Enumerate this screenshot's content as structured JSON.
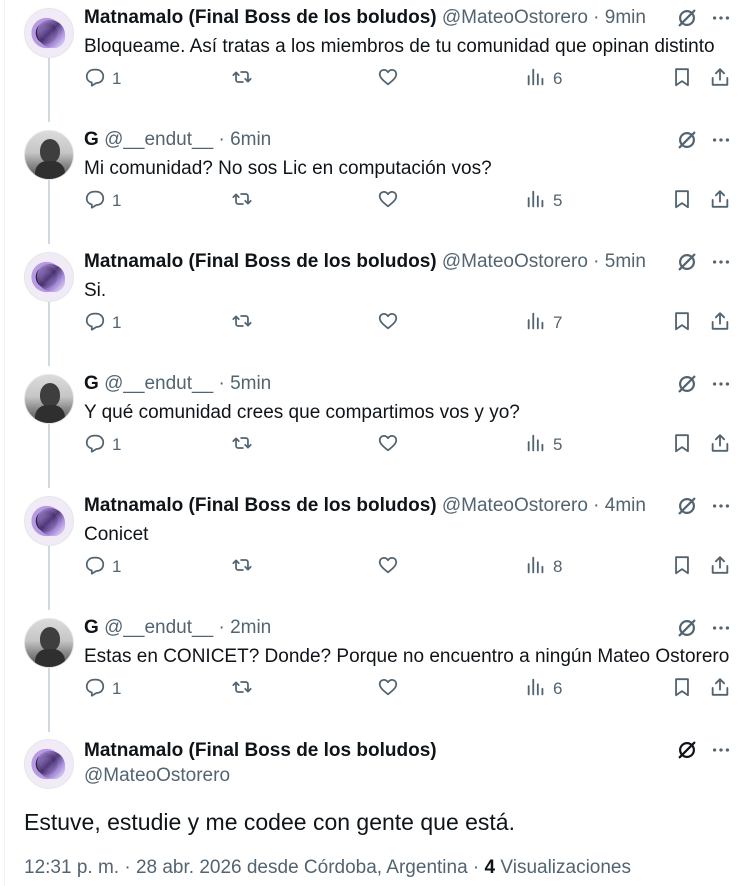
{
  "tweets": [
    {
      "author": "Matnamalo (Final Boss de los boludos)",
      "handle": "@MateoOstorero",
      "separator": "·",
      "time": "9min",
      "avatar": "purple-anime-avatar",
      "text": "Bloqueame. Así tratas a los miembros de tu comunidad que opinan distinto",
      "replies": "1",
      "retweets": "",
      "likes": "",
      "views": "6"
    },
    {
      "author": "G",
      "handle": "@__endut__",
      "separator": "·",
      "time": "6min",
      "avatar": "gray-person-avatar",
      "text": "Mi comunidad? No sos Lic en computación vos?",
      "replies": "1",
      "retweets": "",
      "likes": "",
      "views": "5"
    },
    {
      "author": "Matnamalo (Final Boss de los boludos)",
      "handle": "@MateoOstorero",
      "separator": "·",
      "time": "5min",
      "avatar": "purple-anime-avatar",
      "text": "Si.",
      "replies": "1",
      "retweets": "",
      "likes": "",
      "views": "7"
    },
    {
      "author": "G",
      "handle": "@__endut__",
      "separator": "·",
      "time": "5min",
      "avatar": "gray-person-avatar",
      "text": "Y qué comunidad crees que compartimos vos y yo?",
      "replies": "1",
      "retweets": "",
      "likes": "",
      "views": "5"
    },
    {
      "author": "Matnamalo (Final Boss de los boludos)",
      "handle": "@MateoOstorero",
      "separator": "·",
      "time": "4min",
      "avatar": "purple-anime-avatar",
      "text": "Conicet",
      "replies": "1",
      "retweets": "",
      "likes": "",
      "views": "8"
    },
    {
      "author": "G",
      "handle": "@__endut__",
      "separator": "·",
      "time": "2min",
      "avatar": "gray-person-avatar",
      "text": "Estas en CONICET? Donde? Porque no encuentro a ningún Mateo Ostorero",
      "replies": "1",
      "retweets": "",
      "likes": "",
      "views": "6"
    }
  ],
  "focal": {
    "author": "Matnamalo (Final Boss de los boludos)",
    "handle": "@MateoOstorero",
    "avatar": "purple-anime-avatar",
    "text": "Estuve, estudie y me codee con gente que está.",
    "meta_prefix": "12:31 p. m. · 28 abr. 2026 desde Córdoba, Argentina · ",
    "views_count": "4",
    "views_label": " Visualizaciones"
  },
  "icons": {
    "reply": "reply-icon",
    "retweet": "retweet-icon",
    "like": "heart-icon",
    "views": "bar-chart-icon",
    "bookmark": "bookmark-icon",
    "share": "share-icon",
    "grok": "grok-icon",
    "more": "more-icon"
  },
  "colors": {
    "text": "#0f1419",
    "secondary": "#536471",
    "thread_line": "#cfd9de"
  }
}
